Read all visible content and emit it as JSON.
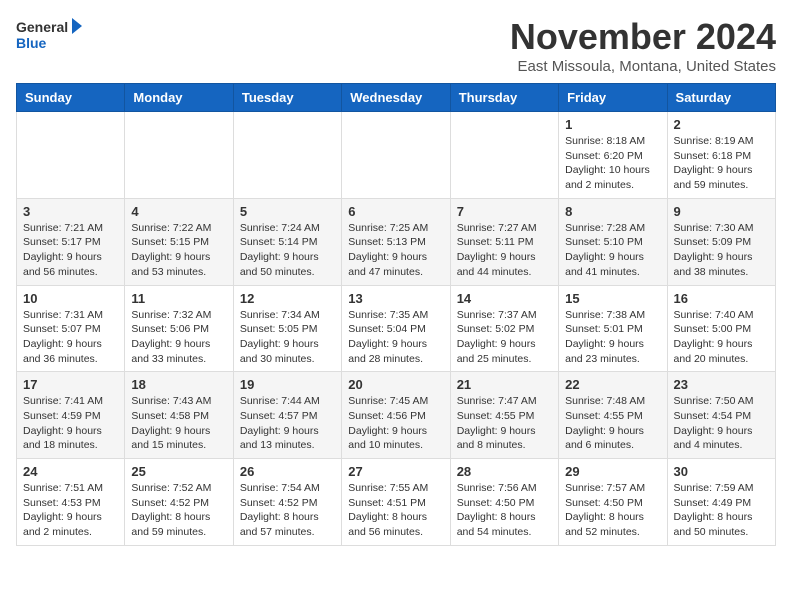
{
  "header": {
    "logo_general": "General",
    "logo_blue": "Blue",
    "month_title": "November 2024",
    "location": "East Missoula, Montana, United States"
  },
  "weekdays": [
    "Sunday",
    "Monday",
    "Tuesday",
    "Wednesday",
    "Thursday",
    "Friday",
    "Saturday"
  ],
  "weeks": [
    [
      {
        "day": "",
        "info": ""
      },
      {
        "day": "",
        "info": ""
      },
      {
        "day": "",
        "info": ""
      },
      {
        "day": "",
        "info": ""
      },
      {
        "day": "",
        "info": ""
      },
      {
        "day": "1",
        "info": "Sunrise: 8:18 AM\nSunset: 6:20 PM\nDaylight: 10 hours\nand 2 minutes."
      },
      {
        "day": "2",
        "info": "Sunrise: 8:19 AM\nSunset: 6:18 PM\nDaylight: 9 hours\nand 59 minutes."
      }
    ],
    [
      {
        "day": "3",
        "info": "Sunrise: 7:21 AM\nSunset: 5:17 PM\nDaylight: 9 hours\nand 56 minutes."
      },
      {
        "day": "4",
        "info": "Sunrise: 7:22 AM\nSunset: 5:15 PM\nDaylight: 9 hours\nand 53 minutes."
      },
      {
        "day": "5",
        "info": "Sunrise: 7:24 AM\nSunset: 5:14 PM\nDaylight: 9 hours\nand 50 minutes."
      },
      {
        "day": "6",
        "info": "Sunrise: 7:25 AM\nSunset: 5:13 PM\nDaylight: 9 hours\nand 47 minutes."
      },
      {
        "day": "7",
        "info": "Sunrise: 7:27 AM\nSunset: 5:11 PM\nDaylight: 9 hours\nand 44 minutes."
      },
      {
        "day": "8",
        "info": "Sunrise: 7:28 AM\nSunset: 5:10 PM\nDaylight: 9 hours\nand 41 minutes."
      },
      {
        "day": "9",
        "info": "Sunrise: 7:30 AM\nSunset: 5:09 PM\nDaylight: 9 hours\nand 38 minutes."
      }
    ],
    [
      {
        "day": "10",
        "info": "Sunrise: 7:31 AM\nSunset: 5:07 PM\nDaylight: 9 hours\nand 36 minutes."
      },
      {
        "day": "11",
        "info": "Sunrise: 7:32 AM\nSunset: 5:06 PM\nDaylight: 9 hours\nand 33 minutes."
      },
      {
        "day": "12",
        "info": "Sunrise: 7:34 AM\nSunset: 5:05 PM\nDaylight: 9 hours\nand 30 minutes."
      },
      {
        "day": "13",
        "info": "Sunrise: 7:35 AM\nSunset: 5:04 PM\nDaylight: 9 hours\nand 28 minutes."
      },
      {
        "day": "14",
        "info": "Sunrise: 7:37 AM\nSunset: 5:02 PM\nDaylight: 9 hours\nand 25 minutes."
      },
      {
        "day": "15",
        "info": "Sunrise: 7:38 AM\nSunset: 5:01 PM\nDaylight: 9 hours\nand 23 minutes."
      },
      {
        "day": "16",
        "info": "Sunrise: 7:40 AM\nSunset: 5:00 PM\nDaylight: 9 hours\nand 20 minutes."
      }
    ],
    [
      {
        "day": "17",
        "info": "Sunrise: 7:41 AM\nSunset: 4:59 PM\nDaylight: 9 hours\nand 18 minutes."
      },
      {
        "day": "18",
        "info": "Sunrise: 7:43 AM\nSunset: 4:58 PM\nDaylight: 9 hours\nand 15 minutes."
      },
      {
        "day": "19",
        "info": "Sunrise: 7:44 AM\nSunset: 4:57 PM\nDaylight: 9 hours\nand 13 minutes."
      },
      {
        "day": "20",
        "info": "Sunrise: 7:45 AM\nSunset: 4:56 PM\nDaylight: 9 hours\nand 10 minutes."
      },
      {
        "day": "21",
        "info": "Sunrise: 7:47 AM\nSunset: 4:55 PM\nDaylight: 9 hours\nand 8 minutes."
      },
      {
        "day": "22",
        "info": "Sunrise: 7:48 AM\nSunset: 4:55 PM\nDaylight: 9 hours\nand 6 minutes."
      },
      {
        "day": "23",
        "info": "Sunrise: 7:50 AM\nSunset: 4:54 PM\nDaylight: 9 hours\nand 4 minutes."
      }
    ],
    [
      {
        "day": "24",
        "info": "Sunrise: 7:51 AM\nSunset: 4:53 PM\nDaylight: 9 hours\nand 2 minutes."
      },
      {
        "day": "25",
        "info": "Sunrise: 7:52 AM\nSunset: 4:52 PM\nDaylight: 8 hours\nand 59 minutes."
      },
      {
        "day": "26",
        "info": "Sunrise: 7:54 AM\nSunset: 4:52 PM\nDaylight: 8 hours\nand 57 minutes."
      },
      {
        "day": "27",
        "info": "Sunrise: 7:55 AM\nSunset: 4:51 PM\nDaylight: 8 hours\nand 56 minutes."
      },
      {
        "day": "28",
        "info": "Sunrise: 7:56 AM\nSunset: 4:50 PM\nDaylight: 8 hours\nand 54 minutes."
      },
      {
        "day": "29",
        "info": "Sunrise: 7:57 AM\nSunset: 4:50 PM\nDaylight: 8 hours\nand 52 minutes."
      },
      {
        "day": "30",
        "info": "Sunrise: 7:59 AM\nSunset: 4:49 PM\nDaylight: 8 hours\nand 50 minutes."
      }
    ]
  ]
}
